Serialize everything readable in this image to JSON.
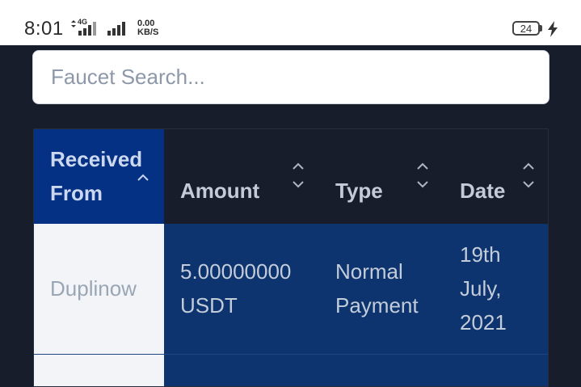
{
  "status_bar": {
    "time": "8:01",
    "network_type": "4G",
    "net_speed_value": "0.00",
    "net_speed_unit": "KB/S",
    "battery": "24"
  },
  "search": {
    "placeholder": "Faucet Search..."
  },
  "table": {
    "columns": [
      {
        "label_line1": "Received",
        "label_line2": "From",
        "sort": "ascending"
      },
      {
        "label": "Amount",
        "sort": "none"
      },
      {
        "label": "Type",
        "sort": "none"
      },
      {
        "label": "Date",
        "sort": "none"
      }
    ],
    "rows": [
      {
        "received_from": "Duplinow",
        "amount_line1": "5.00000000",
        "amount_line2": "USDT",
        "type_line1": "Normal",
        "type_line2": "Payment",
        "date_line1": "19th",
        "date_line2": "July,",
        "date_line3": "2021"
      }
    ]
  },
  "colors": {
    "background": "#171d2b",
    "active_header": "#053185",
    "row": "#0e3470",
    "first_cell": "#f2f4f7"
  },
  "icons": [
    "network-4g-icon",
    "signal-icon",
    "battery-icon",
    "charging-bolt-icon",
    "sort-ascending-icon",
    "sort-both-icon"
  ]
}
